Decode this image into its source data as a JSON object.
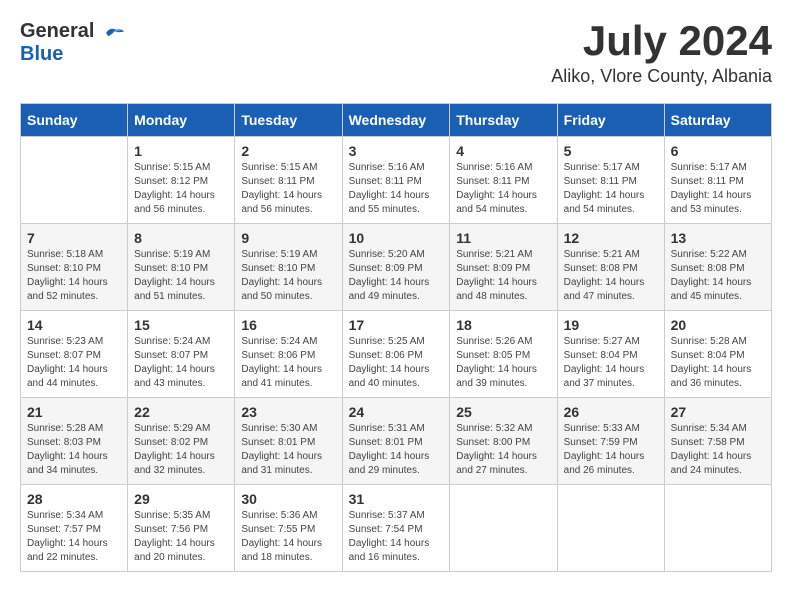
{
  "header": {
    "logo_general": "General",
    "logo_blue": "Blue",
    "month_title": "July 2024",
    "location": "Aliko, Vlore County, Albania"
  },
  "days_of_week": [
    "Sunday",
    "Monday",
    "Tuesday",
    "Wednesday",
    "Thursday",
    "Friday",
    "Saturday"
  ],
  "weeks": [
    [
      {
        "date": "",
        "sunrise": "",
        "sunset": "",
        "daylight": ""
      },
      {
        "date": "1",
        "sunrise": "Sunrise: 5:15 AM",
        "sunset": "Sunset: 8:12 PM",
        "daylight": "Daylight: 14 hours and 56 minutes."
      },
      {
        "date": "2",
        "sunrise": "Sunrise: 5:15 AM",
        "sunset": "Sunset: 8:11 PM",
        "daylight": "Daylight: 14 hours and 56 minutes."
      },
      {
        "date": "3",
        "sunrise": "Sunrise: 5:16 AM",
        "sunset": "Sunset: 8:11 PM",
        "daylight": "Daylight: 14 hours and 55 minutes."
      },
      {
        "date": "4",
        "sunrise": "Sunrise: 5:16 AM",
        "sunset": "Sunset: 8:11 PM",
        "daylight": "Daylight: 14 hours and 54 minutes."
      },
      {
        "date": "5",
        "sunrise": "Sunrise: 5:17 AM",
        "sunset": "Sunset: 8:11 PM",
        "daylight": "Daylight: 14 hours and 54 minutes."
      },
      {
        "date": "6",
        "sunrise": "Sunrise: 5:17 AM",
        "sunset": "Sunset: 8:11 PM",
        "daylight": "Daylight: 14 hours and 53 minutes."
      }
    ],
    [
      {
        "date": "7",
        "sunrise": "Sunrise: 5:18 AM",
        "sunset": "Sunset: 8:10 PM",
        "daylight": "Daylight: 14 hours and 52 minutes."
      },
      {
        "date": "8",
        "sunrise": "Sunrise: 5:19 AM",
        "sunset": "Sunset: 8:10 PM",
        "daylight": "Daylight: 14 hours and 51 minutes."
      },
      {
        "date": "9",
        "sunrise": "Sunrise: 5:19 AM",
        "sunset": "Sunset: 8:10 PM",
        "daylight": "Daylight: 14 hours and 50 minutes."
      },
      {
        "date": "10",
        "sunrise": "Sunrise: 5:20 AM",
        "sunset": "Sunset: 8:09 PM",
        "daylight": "Daylight: 14 hours and 49 minutes."
      },
      {
        "date": "11",
        "sunrise": "Sunrise: 5:21 AM",
        "sunset": "Sunset: 8:09 PM",
        "daylight": "Daylight: 14 hours and 48 minutes."
      },
      {
        "date": "12",
        "sunrise": "Sunrise: 5:21 AM",
        "sunset": "Sunset: 8:08 PM",
        "daylight": "Daylight: 14 hours and 47 minutes."
      },
      {
        "date": "13",
        "sunrise": "Sunrise: 5:22 AM",
        "sunset": "Sunset: 8:08 PM",
        "daylight": "Daylight: 14 hours and 45 minutes."
      }
    ],
    [
      {
        "date": "14",
        "sunrise": "Sunrise: 5:23 AM",
        "sunset": "Sunset: 8:07 PM",
        "daylight": "Daylight: 14 hours and 44 minutes."
      },
      {
        "date": "15",
        "sunrise": "Sunrise: 5:24 AM",
        "sunset": "Sunset: 8:07 PM",
        "daylight": "Daylight: 14 hours and 43 minutes."
      },
      {
        "date": "16",
        "sunrise": "Sunrise: 5:24 AM",
        "sunset": "Sunset: 8:06 PM",
        "daylight": "Daylight: 14 hours and 41 minutes."
      },
      {
        "date": "17",
        "sunrise": "Sunrise: 5:25 AM",
        "sunset": "Sunset: 8:06 PM",
        "daylight": "Daylight: 14 hours and 40 minutes."
      },
      {
        "date": "18",
        "sunrise": "Sunrise: 5:26 AM",
        "sunset": "Sunset: 8:05 PM",
        "daylight": "Daylight: 14 hours and 39 minutes."
      },
      {
        "date": "19",
        "sunrise": "Sunrise: 5:27 AM",
        "sunset": "Sunset: 8:04 PM",
        "daylight": "Daylight: 14 hours and 37 minutes."
      },
      {
        "date": "20",
        "sunrise": "Sunrise: 5:28 AM",
        "sunset": "Sunset: 8:04 PM",
        "daylight": "Daylight: 14 hours and 36 minutes."
      }
    ],
    [
      {
        "date": "21",
        "sunrise": "Sunrise: 5:28 AM",
        "sunset": "Sunset: 8:03 PM",
        "daylight": "Daylight: 14 hours and 34 minutes."
      },
      {
        "date": "22",
        "sunrise": "Sunrise: 5:29 AM",
        "sunset": "Sunset: 8:02 PM",
        "daylight": "Daylight: 14 hours and 32 minutes."
      },
      {
        "date": "23",
        "sunrise": "Sunrise: 5:30 AM",
        "sunset": "Sunset: 8:01 PM",
        "daylight": "Daylight: 14 hours and 31 minutes."
      },
      {
        "date": "24",
        "sunrise": "Sunrise: 5:31 AM",
        "sunset": "Sunset: 8:01 PM",
        "daylight": "Daylight: 14 hours and 29 minutes."
      },
      {
        "date": "25",
        "sunrise": "Sunrise: 5:32 AM",
        "sunset": "Sunset: 8:00 PM",
        "daylight": "Daylight: 14 hours and 27 minutes."
      },
      {
        "date": "26",
        "sunrise": "Sunrise: 5:33 AM",
        "sunset": "Sunset: 7:59 PM",
        "daylight": "Daylight: 14 hours and 26 minutes."
      },
      {
        "date": "27",
        "sunrise": "Sunrise: 5:34 AM",
        "sunset": "Sunset: 7:58 PM",
        "daylight": "Daylight: 14 hours and 24 minutes."
      }
    ],
    [
      {
        "date": "28",
        "sunrise": "Sunrise: 5:34 AM",
        "sunset": "Sunset: 7:57 PM",
        "daylight": "Daylight: 14 hours and 22 minutes."
      },
      {
        "date": "29",
        "sunrise": "Sunrise: 5:35 AM",
        "sunset": "Sunset: 7:56 PM",
        "daylight": "Daylight: 14 hours and 20 minutes."
      },
      {
        "date": "30",
        "sunrise": "Sunrise: 5:36 AM",
        "sunset": "Sunset: 7:55 PM",
        "daylight": "Daylight: 14 hours and 18 minutes."
      },
      {
        "date": "31",
        "sunrise": "Sunrise: 5:37 AM",
        "sunset": "Sunset: 7:54 PM",
        "daylight": "Daylight: 14 hours and 16 minutes."
      },
      {
        "date": "",
        "sunrise": "",
        "sunset": "",
        "daylight": ""
      },
      {
        "date": "",
        "sunrise": "",
        "sunset": "",
        "daylight": ""
      },
      {
        "date": "",
        "sunrise": "",
        "sunset": "",
        "daylight": ""
      }
    ]
  ]
}
